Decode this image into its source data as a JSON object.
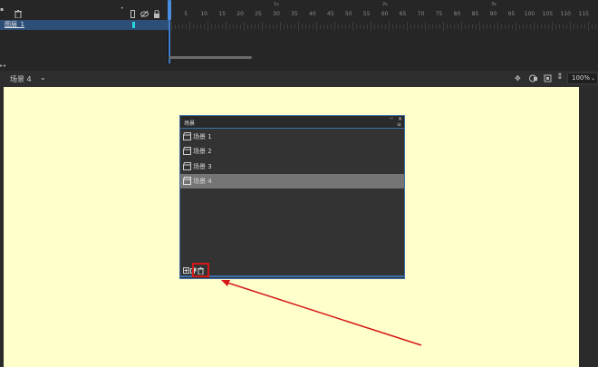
{
  "timeline": {
    "layer_name": "图层_1",
    "frame_numbers": [
      "5",
      "10",
      "15",
      "20",
      "25",
      "30",
      "35",
      "40",
      "45",
      "50",
      "55",
      "60",
      "65",
      "70",
      "75",
      "80",
      "85",
      "90",
      "95",
      "100",
      "105",
      "110",
      "115"
    ],
    "second_markers": [
      "1s",
      "2s",
      "3s"
    ],
    "icons": [
      "delete-layer-icon",
      "dot-icon",
      "layer-outline-icon",
      "hide-icon",
      "lock-icon"
    ]
  },
  "scene_bar": {
    "current_scene": "场景 4",
    "zoom": "100%",
    "icons": [
      "center-stage-icon",
      "clip-icon",
      "frame-icon",
      "rotate-icon"
    ]
  },
  "scene_panel": {
    "title": "场景",
    "scenes": [
      {
        "label": "场景 1",
        "selected": false
      },
      {
        "label": "场景 2",
        "selected": false
      },
      {
        "label": "场景 3",
        "selected": false
      },
      {
        "label": "场景 4",
        "selected": true
      }
    ],
    "bottom_buttons": [
      "add-scene-icon",
      "duplicate-scene-icon",
      "delete-scene-icon"
    ]
  },
  "colors": {
    "stage": "#ffffcc",
    "highlight": "#d41818",
    "accent": "#3c6ea8",
    "layer_color": "#27d5e0"
  }
}
